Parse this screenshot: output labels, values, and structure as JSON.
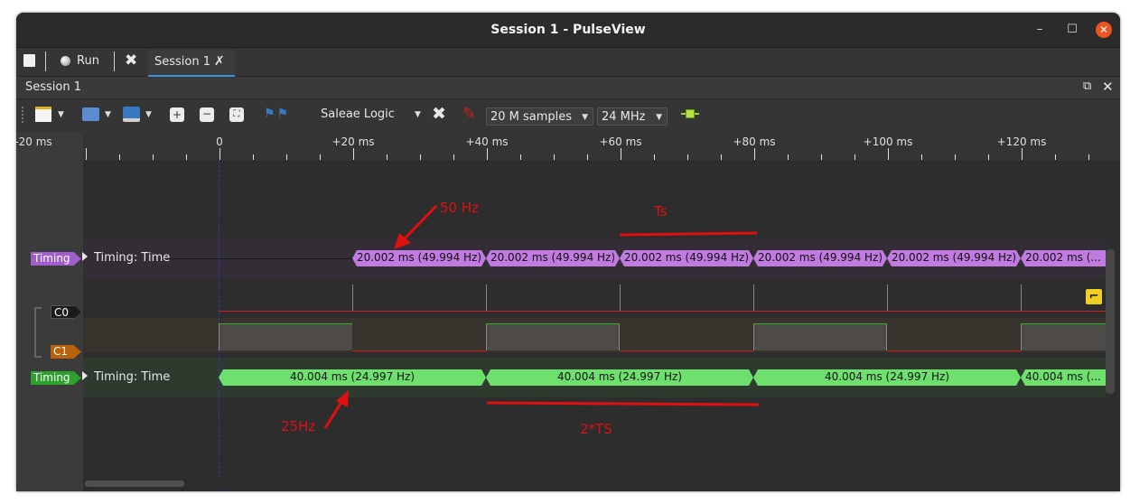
{
  "window": {
    "title": "Session 1 - PulseView"
  },
  "main_toolbar": {
    "run_label": "Run",
    "session_tab": "Session 1"
  },
  "dock": {
    "title": "Session 1"
  },
  "device_toolbar": {
    "device": "Saleae Logic",
    "samples": "20 M samples",
    "samplerate": "24 MHz"
  },
  "ruler": {
    "ticks": [
      "-20 ms",
      "0",
      "+20 ms",
      "+40 ms",
      "+60 ms",
      "+80 ms",
      "+100 ms",
      "+120 ms"
    ]
  },
  "rows": {
    "timing1": {
      "tag": "Timing",
      "label": "Timing: Time",
      "color": "#a05ecc",
      "annotations": [
        "20.002 ms (49.994 Hz)",
        "20.002 ms (49.994 Hz)",
        "20.002 ms (49.994 Hz)",
        "20.002 ms (49.994 Hz)",
        "20.002 ms (49.994 Hz)",
        "20.002 ms (..."
      ]
    },
    "c0": {
      "tag": "C0",
      "color": "#1a1a1a"
    },
    "c1": {
      "tag": "C1",
      "color": "#b8620c"
    },
    "timing2": {
      "tag": "Timing",
      "label": "Timing: Time",
      "color": "#2ea02e",
      "annotations": [
        "40.004 ms (24.997 Hz)",
        "40.004 ms (24.997 Hz)",
        "40.004 ms (24.997 Hz)",
        "40.004 ms (..."
      ]
    }
  },
  "overlay": {
    "hz50": "50 Hz",
    "ts": "Ts",
    "hz25": "25Hz",
    "two_ts": "2*TS"
  }
}
